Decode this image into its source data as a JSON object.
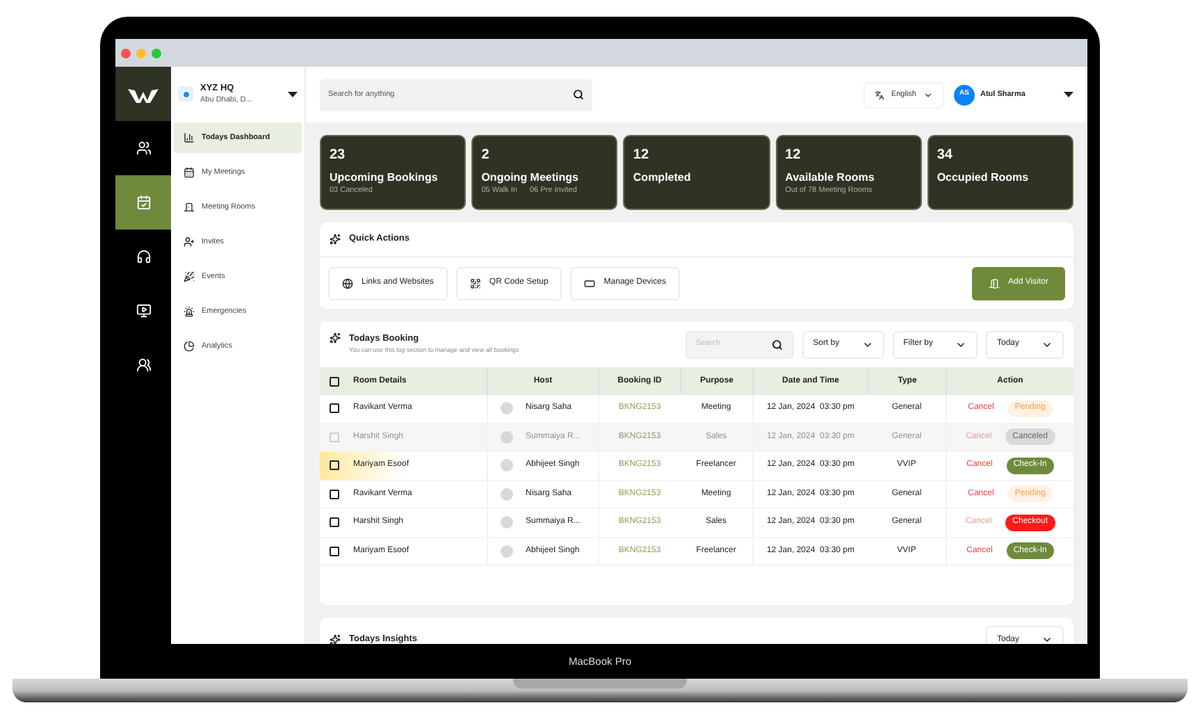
{
  "rail": {
    "items": [
      {
        "kind": "people",
        "selected": false
      },
      {
        "kind": "calendar",
        "selected": true
      },
      {
        "kind": "support",
        "selected": false
      },
      {
        "kind": "media",
        "selected": false
      },
      {
        "kind": "group",
        "selected": false
      }
    ]
  },
  "location": {
    "name": "XYZ HQ",
    "address": "Abu Dhabi, D..."
  },
  "sidebar": {
    "items": [
      {
        "label": "Todays Dashboard",
        "kind": "dashboard",
        "selected": true
      },
      {
        "label": "My Meetings",
        "kind": "meetings",
        "selected": false
      },
      {
        "label": "Meeting Rooms",
        "kind": "rooms",
        "selected": false
      },
      {
        "label": "Invites",
        "kind": "invites",
        "selected": false
      },
      {
        "label": "Events",
        "kind": "events",
        "selected": false
      },
      {
        "label": "Emergencies",
        "kind": "emergencies",
        "selected": false
      },
      {
        "label": "Analytics",
        "kind": "analytics",
        "selected": false
      }
    ]
  },
  "header": {
    "search": {
      "placeholder": "Search for anything"
    },
    "language": "English",
    "user": {
      "initials": "AS",
      "name": "Atul Sharma"
    }
  },
  "stats": [
    {
      "value": "23",
      "title": "Upcoming Bookings",
      "notes": [
        "03 Canceled"
      ]
    },
    {
      "value": "2",
      "title": "Ongoing Meetings",
      "notes": [
        "05 Walk In",
        "06 Pre Invited"
      ]
    },
    {
      "value": "12",
      "title": "Completed"
    },
    {
      "value": "12",
      "title": "Available Rooms",
      "notes": [
        "Out of 78 Meeting Rooms"
      ]
    },
    {
      "value": "34",
      "title": "Occupied Rooms"
    }
  ],
  "quick_actions": {
    "title": "Quick Actions",
    "actions": [
      {
        "label": "Links and Websites",
        "kind": "globe"
      },
      {
        "label": "QR Code Setup",
        "kind": "qr"
      },
      {
        "label": "Manage Devices",
        "kind": "device"
      }
    ],
    "add_button": "Add Visitor"
  },
  "booking": {
    "title": "Todays Booking",
    "subtitle": "You can use this log section to manage and view all bookings",
    "search": {
      "placeholder": "Search"
    },
    "filters": [
      "Sort by",
      "Filter by",
      "Today"
    ],
    "select_all_checked": false,
    "columns": [
      "Room Details",
      "Host",
      "Booking ID",
      "Purpose",
      "Date and Time",
      "Type",
      "Action"
    ],
    "rows": [
      {
        "checked": false,
        "disabled": false,
        "highlighted": false,
        "room": "Ravikant Verma",
        "host": "Nisarg Saha",
        "booking_id": "BKNG2153",
        "purpose": "Meeting",
        "date": "12 Jan, 2024  03:30 pm",
        "type": "General",
        "cancel": "Cancel",
        "cancel_disabled": false,
        "status": {
          "label": "Pending",
          "kind": "pending"
        }
      },
      {
        "checked": false,
        "disabled": true,
        "highlighted": false,
        "room": "Harshit Singh",
        "host": "Summaiya R...",
        "booking_id": "BKNG2153",
        "purpose": "Sales",
        "date": "12 Jan, 2024  03:30 pm",
        "type": "General",
        "cancel": "Cancel",
        "cancel_disabled": true,
        "status": {
          "label": "Canceled",
          "kind": "canceled"
        }
      },
      {
        "checked": false,
        "disabled": false,
        "highlighted": true,
        "room": "Mariyam Esoof",
        "host": "Abhijeet Singh",
        "booking_id": "BKNG2153",
        "purpose": "Freelancer",
        "date": "12 Jan, 2024  03:30 pm",
        "type": "VVIP",
        "cancel": "Cancel",
        "cancel_disabled": false,
        "status": {
          "label": "Check-In",
          "kind": "checkin"
        }
      },
      {
        "checked": false,
        "disabled": false,
        "highlighted": false,
        "room": "Ravikant Verma",
        "host": "Nisarg Saha",
        "booking_id": "BKNG2153",
        "purpose": "Meeting",
        "date": "12 Jan, 2024  03:30 pm",
        "type": "General",
        "cancel": "Cancel",
        "cancel_disabled": false,
        "status": {
          "label": "Pending",
          "kind": "pending"
        }
      },
      {
        "checked": false,
        "disabled": false,
        "highlighted": false,
        "room": "Harshit Singh",
        "host": "Summaiya R...",
        "booking_id": "BKNG2153",
        "purpose": "Sales",
        "date": "12 Jan, 2024  03:30 pm",
        "type": "General",
        "cancel": "Cancel",
        "cancel_disabled": true,
        "status": {
          "label": "Checkout",
          "kind": "checkout"
        }
      },
      {
        "checked": false,
        "disabled": false,
        "highlighted": false,
        "room": "Mariyam Esoof",
        "host": "Abhijeet Singh",
        "booking_id": "BKNG2153",
        "purpose": "Freelancer",
        "date": "12 Jan, 2024  03:30 pm",
        "type": "VVIP",
        "cancel": "Cancel",
        "cancel_disabled": false,
        "status": {
          "label": "Check-In",
          "kind": "checkin"
        }
      }
    ]
  },
  "insights": {
    "title": "Todays Insights",
    "filter": "Today"
  },
  "laptop": {
    "label": "MacBook Pro"
  }
}
